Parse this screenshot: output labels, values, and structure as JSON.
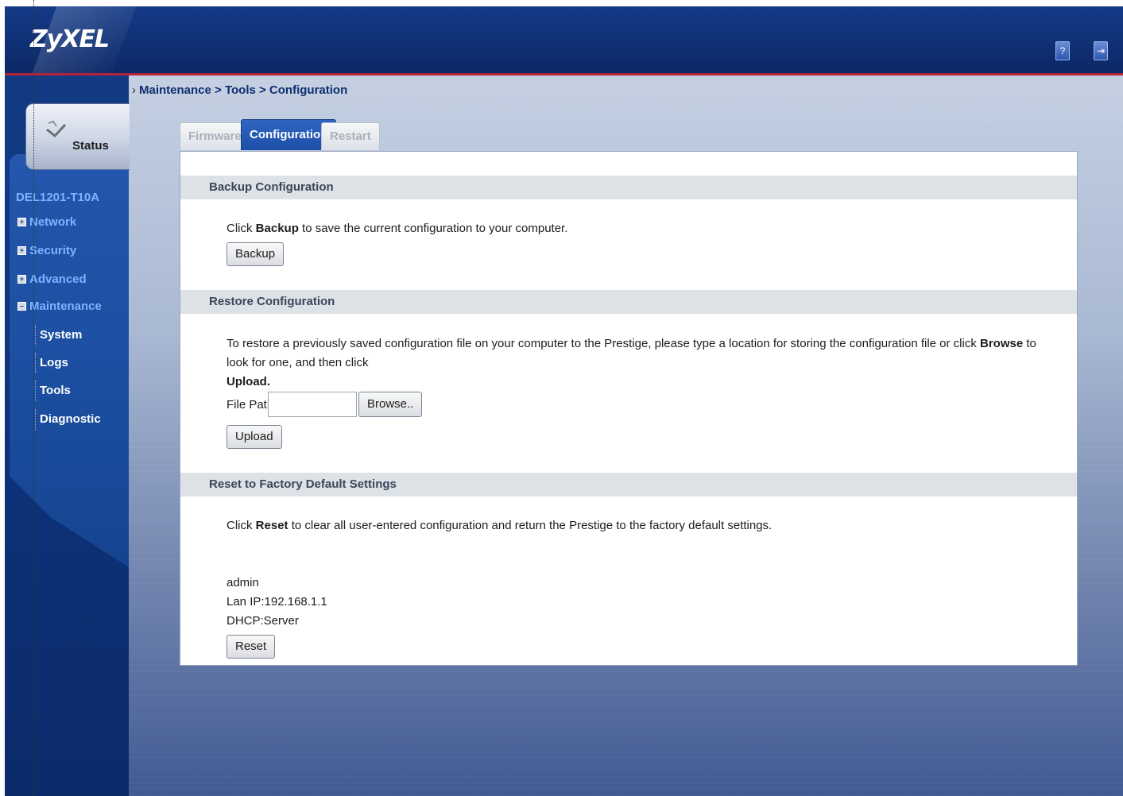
{
  "header": {
    "logo": "ZyXEL",
    "icons": [
      "wizard-icon",
      "logout-icon"
    ]
  },
  "breadcrumb": "Maintenance > Tools > Configuration",
  "sidebar": {
    "status_label": "Status",
    "device_name": "DEL1201-T10A",
    "items": [
      {
        "label": "Network",
        "expanded": false
      },
      {
        "label": "Security",
        "expanded": false
      },
      {
        "label": "Advanced",
        "expanded": false
      },
      {
        "label": "Maintenance",
        "expanded": true
      }
    ],
    "subitems": [
      "System",
      "Logs",
      "Tools",
      "Diagnostic"
    ]
  },
  "tabs": [
    {
      "label": "Firmware",
      "active": false
    },
    {
      "label": "Configuration",
      "active": true
    },
    {
      "label": "Restart",
      "active": false
    }
  ],
  "backup": {
    "title": "Backup Configuration",
    "text_pre": "Click ",
    "text_bold": "Backup",
    "text_post": " to save the current configuration to your computer.",
    "button": "Backup"
  },
  "restore": {
    "title": "Restore Configuration",
    "text_pre": "To restore a previously saved configuration file on your computer to the Prestige, please type a location for storing the configuration file or click ",
    "text_bold1": "Browse",
    "text_mid": " to look for one, and then click",
    "text_bold2": "Upload.",
    "file_path_label": "File Path:",
    "file_path_value": "",
    "browse_button": "Browse..",
    "upload_button": "Upload"
  },
  "reset": {
    "title": "Reset to Factory Default Settings",
    "text_pre": "Click ",
    "text_bold": "Reset",
    "text_post": " to clear all user-entered configuration and return the Prestige to the factory default settings.",
    "info": [
      "admin",
      "Lan IP:192.168.1.1",
      "DHCP:Server"
    ],
    "button": "Reset"
  },
  "colors": {
    "header_blue": "#143a86",
    "accent_red": "#b0243a",
    "nav_link": "#7fb3ff",
    "active_tab": "#2f66c4"
  }
}
